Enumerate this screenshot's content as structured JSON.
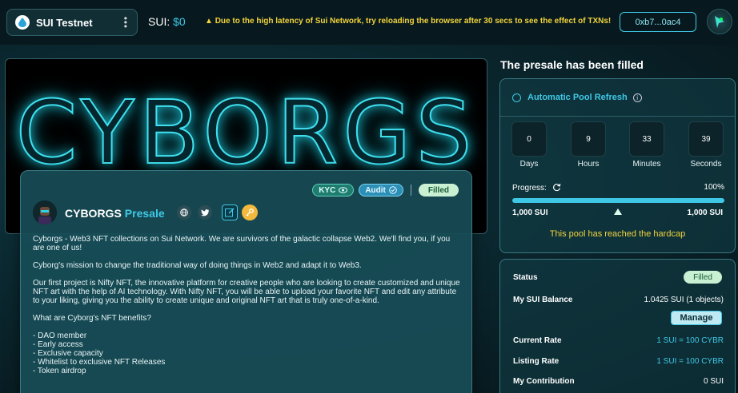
{
  "topbar": {
    "network_label": "SUI Testnet",
    "balance_label": "SUI:",
    "balance_value": "$0",
    "warning": "Due to the high latency of Sui Network, try reloading the browser after 30 secs to see the effect of TXNs!",
    "address": "0xb7...0ac4"
  },
  "banner": {
    "title": "CYBORGS"
  },
  "project": {
    "badges": {
      "kyc": "KYC",
      "audit": "Audit",
      "status": "Filled"
    },
    "name": "CYBORGS",
    "name_suffix": "Presale",
    "paragraphs": [
      "Cyborgs - Web3 NFT collections on Sui Network. We are survivors of the galactic collapse Web2. We'll find you, if you are one of us!",
      "Cyborg's mission to change the traditional way of doing things in Web2 and adapt it to Web3.",
      "Our first project is Nifty NFT, the innovative platform for creative people who are looking to create customized and unique NFT art with the help of AI technology. With Nifty NFT, you will be able to upload your favorite NFT and edit any attribute to your liking, giving you the ability to create unique and original NFT art that is truly one-of-a-kind.",
      "What are Cyborg's NFT benefits?"
    ],
    "benefits": [
      "- DAO member",
      "- Early access",
      "- Exclusive capacity",
      "- Whitelist to exclusive NFT Releases",
      "- Token airdrop"
    ]
  },
  "pool": {
    "heading": "The presale has been filled",
    "refresh_label": "Automatic Pool Refresh",
    "countdown": [
      {
        "value": "0",
        "label": "Days"
      },
      {
        "value": "9",
        "label": "Hours"
      },
      {
        "value": "33",
        "label": "Minutes"
      },
      {
        "value": "39",
        "label": "Seconds"
      }
    ],
    "progress_label": "Progress:",
    "progress_percent": "100%",
    "progress_fraction": 1.0,
    "progress_min": "1,000 SUI",
    "progress_max": "1,000 SUI",
    "hardcap_msg": "This pool has reached the hardcap"
  },
  "status": {
    "status_label": "Status",
    "status_value": "Filled",
    "balance_label": "My SUI Balance",
    "balance_value": "1.0425 SUI (1 objects)",
    "manage_label": "Manage",
    "rate_label": "Current Rate",
    "rate_value": "1 SUI = 100 CYBR",
    "listing_label": "Listing Rate",
    "listing_value": "1 SUI = 100 CYBR",
    "contrib_label": "My Contribution",
    "contrib_value": "0 SUI"
  },
  "colors": {
    "accent": "#3fc8e6",
    "warning": "#f2d33c",
    "filled_badge": "#c9f0d2"
  }
}
